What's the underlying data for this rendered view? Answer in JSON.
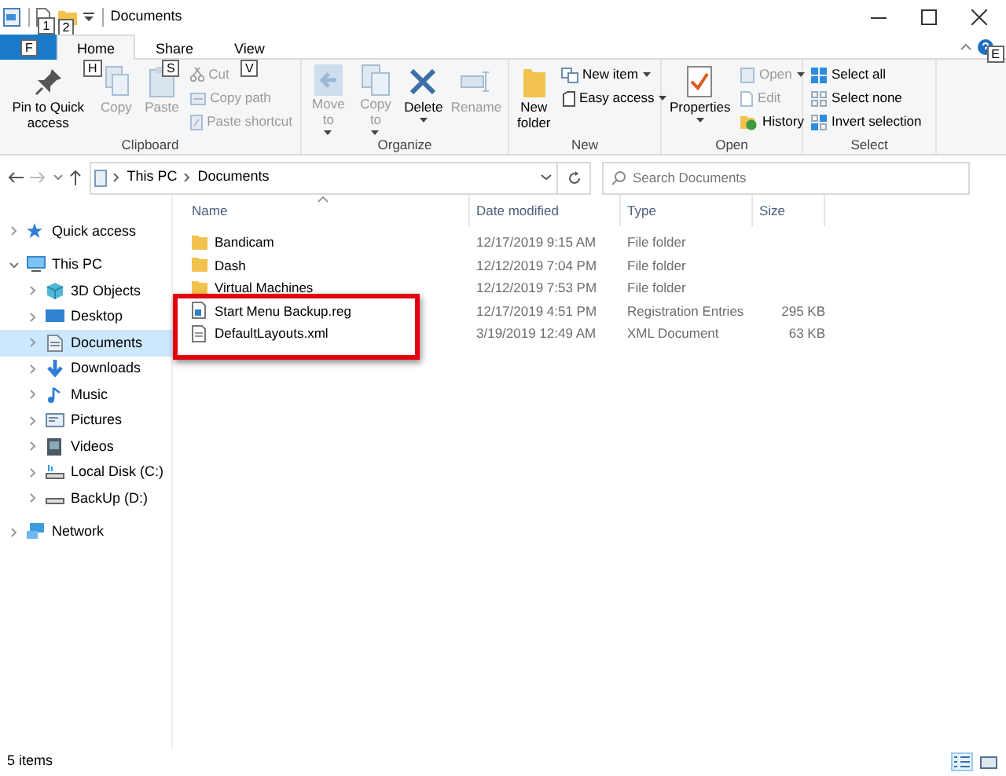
{
  "window": {
    "title": "Documents",
    "qat_keytips": [
      "1",
      "2"
    ]
  },
  "ribbon_tabs": {
    "file_keytip": "F",
    "help_keytip": "E",
    "tabs": [
      {
        "label": "Home",
        "keytip": "H",
        "selected": true
      },
      {
        "label": "Share",
        "keytip": "S",
        "selected": false
      },
      {
        "label": "View",
        "keytip": "V",
        "selected": false
      }
    ]
  },
  "ribbon": {
    "groups": [
      {
        "label": "Clipboard",
        "buttons": [
          {
            "kind": "large",
            "label": "Pin to Quick access",
            "disabled": false,
            "dropdown": false
          },
          {
            "kind": "large",
            "label": "Copy",
            "disabled": true,
            "dropdown": false
          },
          {
            "kind": "large",
            "label": "Paste",
            "disabled": true,
            "dropdown": false
          },
          {
            "kind": "small",
            "label": "Cut",
            "disabled": true,
            "dropdown": false
          },
          {
            "kind": "small",
            "label": "Copy path",
            "disabled": true,
            "dropdown": false
          },
          {
            "kind": "small",
            "label": "Paste shortcut",
            "disabled": true,
            "dropdown": false
          }
        ]
      },
      {
        "label": "Organize",
        "buttons": [
          {
            "kind": "large",
            "label": "Move to",
            "disabled": true,
            "dropdown": true
          },
          {
            "kind": "large",
            "label": "Copy to",
            "disabled": true,
            "dropdown": true
          },
          {
            "kind": "large",
            "label": "Delete",
            "disabled": false,
            "dropdown": true
          },
          {
            "kind": "large",
            "label": "Rename",
            "disabled": true,
            "dropdown": false
          }
        ]
      },
      {
        "label": "New",
        "buttons": [
          {
            "kind": "large",
            "label": "New folder",
            "disabled": false,
            "dropdown": false
          },
          {
            "kind": "small",
            "label": "New item",
            "disabled": false,
            "dropdown": true
          },
          {
            "kind": "small",
            "label": "Easy access",
            "disabled": false,
            "dropdown": true
          }
        ]
      },
      {
        "label": "Open",
        "buttons": [
          {
            "kind": "large",
            "label": "Properties",
            "disabled": false,
            "dropdown": true
          },
          {
            "kind": "small",
            "label": "Open",
            "disabled": true,
            "dropdown": true
          },
          {
            "kind": "small",
            "label": "Edit",
            "disabled": true,
            "dropdown": false
          },
          {
            "kind": "small",
            "label": "History",
            "disabled": false,
            "dropdown": false
          }
        ]
      },
      {
        "label": "Select",
        "buttons": [
          {
            "kind": "small",
            "label": "Select all",
            "disabled": false,
            "dropdown": false
          },
          {
            "kind": "small",
            "label": "Select none",
            "disabled": false,
            "dropdown": false
          },
          {
            "kind": "small",
            "label": "Invert selection",
            "disabled": false,
            "dropdown": false
          }
        ]
      }
    ]
  },
  "address_bar": {
    "path": [
      "This PC",
      "Documents"
    ],
    "search_placeholder": "Search Documents"
  },
  "sidebar": {
    "items": [
      {
        "label": "Quick access",
        "kind": "star",
        "expanded": false,
        "selected": false
      },
      {
        "label": "This PC",
        "kind": "pc",
        "expanded": true,
        "selected": false,
        "children": [
          {
            "label": "3D Objects",
            "kind": "cube",
            "expanded": false,
            "selected": false
          },
          {
            "label": "Desktop",
            "kind": "desktop",
            "expanded": false,
            "selected": false
          },
          {
            "label": "Documents",
            "kind": "documents",
            "expanded": false,
            "selected": true
          },
          {
            "label": "Downloads",
            "kind": "downloads",
            "expanded": false,
            "selected": false
          },
          {
            "label": "Music",
            "kind": "music",
            "expanded": false,
            "selected": false
          },
          {
            "label": "Pictures",
            "kind": "pictures",
            "expanded": false,
            "selected": false
          },
          {
            "label": "Videos",
            "kind": "videos",
            "expanded": false,
            "selected": false
          },
          {
            "label": "Local Disk (C:)",
            "kind": "disk",
            "expanded": false,
            "selected": false
          },
          {
            "label": "BackUp (D:)",
            "kind": "drive",
            "expanded": false,
            "selected": false
          }
        ]
      },
      {
        "label": "Network",
        "kind": "network",
        "expanded": false,
        "selected": false
      }
    ]
  },
  "table": {
    "columns": [
      "Name",
      "Date modified",
      "Type",
      "Size"
    ],
    "rows": [
      {
        "kind": "folder",
        "name": "Bandicam",
        "date": "12/17/2019 9:15 AM",
        "type": "File folder",
        "highlighted": false
      },
      {
        "kind": "folder",
        "name": "Dash",
        "date": "12/12/2019 7:04 PM",
        "type": "File folder",
        "highlighted": false
      },
      {
        "kind": "folder",
        "name": "Virtual Machines",
        "date": "12/12/2019 7:53 PM",
        "type": "File folder",
        "highlighted": false
      },
      {
        "kind": "reg",
        "name": "Start Menu Backup.reg",
        "date": "12/17/2019 4:51 PM",
        "type": "Registration Entries",
        "size": "295 KB",
        "highlighted": true
      },
      {
        "kind": "xml",
        "name": "DefaultLayouts.xml",
        "date": "3/19/2019 12:49 AM",
        "type": "XML Document",
        "size": "63 KB",
        "highlighted": true
      }
    ]
  },
  "status_bar": {
    "text": "5 items",
    "views": [
      {
        "selected": true
      },
      {
        "selected": false
      }
    ]
  }
}
